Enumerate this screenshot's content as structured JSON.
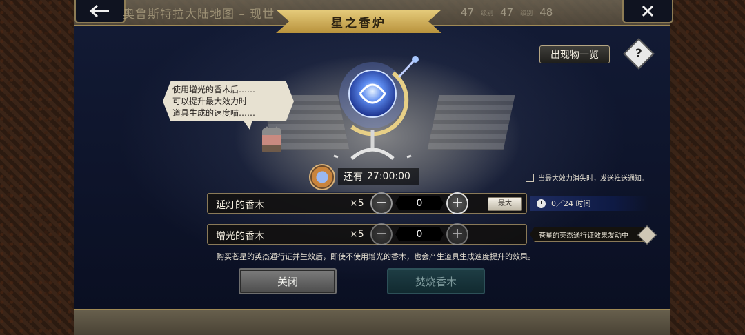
{
  "header": {
    "back_icon": "back-arrow-icon",
    "map_title": "奥鲁斯特拉大陆地图 – 现世",
    "stats": [
      {
        "value": "47",
        "label": "级别"
      },
      {
        "value": "47",
        "label": "级别"
      },
      {
        "value": "48",
        "label": ""
      }
    ],
    "close_icon": "close-icon"
  },
  "dialog": {
    "title": "星之香炉",
    "list_button": "出现物一览",
    "help_label": "?",
    "speech_lines": [
      "使用增光的香木后……",
      "可以提升最大效力时",
      "道具生成的速度喵……"
    ],
    "timer_prefix": "还有",
    "timer_value": "27:00:00",
    "notify_label": "当最大效力消失时，发送推送通知。",
    "items": [
      {
        "name": "延灯的香木",
        "multiplier": "×5",
        "quantity": "0",
        "extra_button": "最大"
      },
      {
        "name": "增光的香木",
        "multiplier": "×5",
        "quantity": "0"
      }
    ],
    "time_info": "0／24 时间",
    "pass_info": "苍星的英杰通行证效果发动中",
    "note": "购买苍星的英杰通行证并生效后，即使不使用增光的香木，也会产生道具生成速度提升的效果。",
    "close_button": "关闭",
    "burn_button": "焚烧香木"
  },
  "colors": {
    "gold": "#d4b060",
    "panel": "#0f1530",
    "burn_disabled": "#1e3d44"
  }
}
